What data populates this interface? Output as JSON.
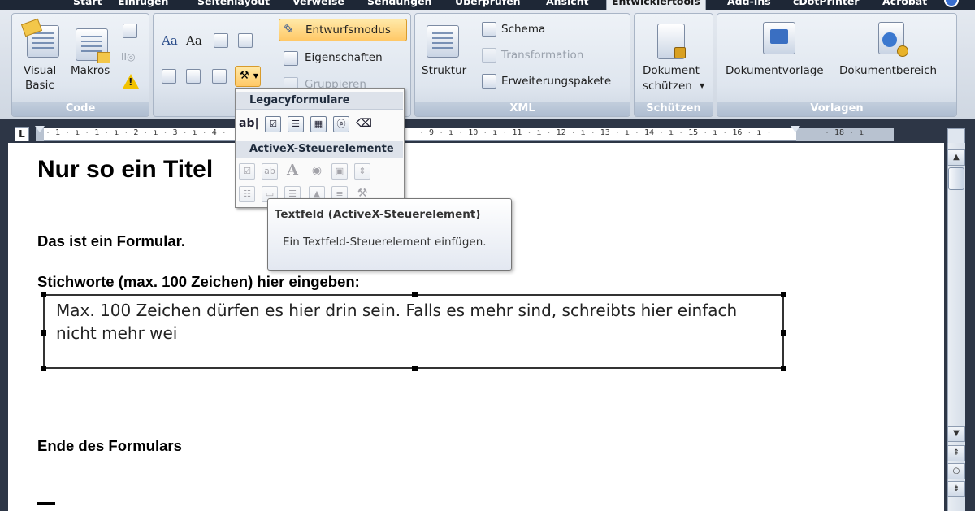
{
  "tabs": [
    {
      "label": "Start",
      "active": false
    },
    {
      "label": "Einfügen",
      "active": false
    },
    {
      "label": "Seitenlayout",
      "active": false
    },
    {
      "label": "Verweise",
      "active": false
    },
    {
      "label": "Sendungen",
      "active": false
    },
    {
      "label": "Überprüfen",
      "active": false
    },
    {
      "label": "Ansicht",
      "active": false
    },
    {
      "label": "Entwicklertools",
      "active": true
    },
    {
      "label": "Add-Ins",
      "active": false
    },
    {
      "label": "cDotPrinter",
      "active": false
    },
    {
      "label": "Acrobat",
      "active": false
    }
  ],
  "ribbon": {
    "code": {
      "label": "Code",
      "visual_basic_line1": "Visual",
      "visual_basic_line2": "Basic",
      "macros": "Makros"
    },
    "controls": {
      "design_mode": "Entwurfsmodus",
      "properties": "Eigenschaften",
      "group": "Gruppieren"
    },
    "xml": {
      "label": "XML",
      "structure": "Struktur",
      "schema": "Schema",
      "transformation": "Transformation",
      "expansion_packs": "Erweiterungspakete"
    },
    "protect": {
      "label": "Schützen",
      "protect_document_line1": "Dokument",
      "protect_document_line2": "schützen"
    },
    "templates": {
      "label": "Vorlagen",
      "document_template": "Dokumentvorlage",
      "document_panel": "Dokumentbereich"
    }
  },
  "ruler": {
    "tab_stop": "L",
    "numbers": "· 1 · ı · 1 · ı · 2 · ı · 3 · ı · 4 ·",
    "numbers_right": "· 9 · ı · 10 · ı · 11 · ı · 12 · ı · 13 · ı · 14 · ı · 15 · ı · 16 · ı ·",
    "numbers_far": "· 18 · ı"
  },
  "document": {
    "title": "Nur so ein Titel",
    "intro": "Das ist ein Formular.",
    "prompt": "Stichworte (max. 100 Zeichen) hier eingeben:",
    "textfield_value": "Max. 100 Zeichen dürfen es hier drin sein. Falls es mehr sind, schreibts hier einfach nicht mehr wei",
    "footer": "Ende des Formulars"
  },
  "dropdown": {
    "legacy_header": "Legacyformulare",
    "activex_header": "ActiveX-Steuerelemente",
    "legacy_text_icon": "ab|"
  },
  "tooltip": {
    "title": "Textfeld (ActiveX-Steuerelement)",
    "body": "Ein Textfeld-Steuerelement einfügen."
  }
}
